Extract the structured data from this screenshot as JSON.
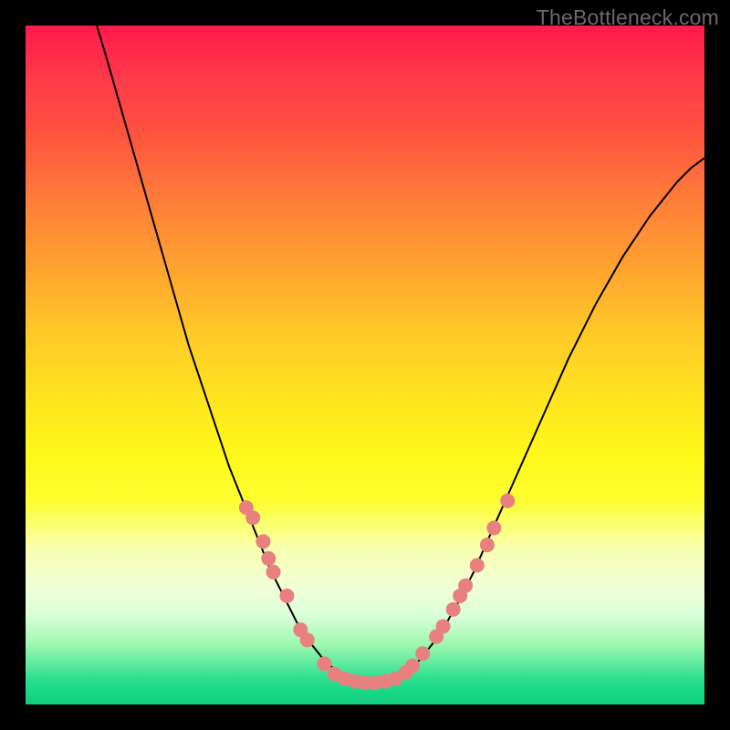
{
  "watermark": "TheBottleneck.com",
  "chart_data": {
    "type": "line",
    "title": "",
    "xlabel": "",
    "ylabel": "",
    "xlim": [
      0,
      100
    ],
    "ylim": [
      0,
      100
    ],
    "curve": {
      "comment": "V-shaped bottleneck curve; x in 0..100 plot units, y is 0 (top) to 100 (bottom) visually mapped — stored as y=percent from top",
      "points": [
        [
          10.5,
          0
        ],
        [
          12,
          5
        ],
        [
          14,
          12
        ],
        [
          16,
          19
        ],
        [
          18,
          26
        ],
        [
          20,
          33
        ],
        [
          22,
          40
        ],
        [
          24,
          47
        ],
        [
          26,
          53
        ],
        [
          28,
          59
        ],
        [
          30,
          65
        ],
        [
          32,
          70
        ],
        [
          34,
          75
        ],
        [
          36,
          80
        ],
        [
          38,
          84
        ],
        [
          40,
          88
        ],
        [
          42,
          91
        ],
        [
          44,
          93.5
        ],
        [
          46,
          95.3
        ],
        [
          48,
          96.3
        ],
        [
          50,
          96.7
        ],
        [
          52,
          96.7
        ],
        [
          54,
          96.3
        ],
        [
          56,
          95.2
        ],
        [
          58,
          93.5
        ],
        [
          60,
          91
        ],
        [
          62,
          88
        ],
        [
          64,
          84.5
        ],
        [
          66,
          80.5
        ],
        [
          68,
          76
        ],
        [
          70,
          71.5
        ],
        [
          72,
          67
        ],
        [
          74,
          62.5
        ],
        [
          76,
          58
        ],
        [
          78,
          53.5
        ],
        [
          80,
          49
        ],
        [
          82,
          45
        ],
        [
          84,
          41
        ],
        [
          86,
          37.5
        ],
        [
          88,
          34
        ],
        [
          90,
          31
        ],
        [
          92,
          28
        ],
        [
          94,
          25.5
        ],
        [
          96,
          23
        ],
        [
          98,
          21
        ],
        [
          100,
          19.5
        ]
      ]
    },
    "scatter_points": {
      "comment": "Salmon/pink data markers along the V; x,y in same 0..100 plot-percent space",
      "points": [
        [
          32.5,
          71
        ],
        [
          33.5,
          72.5
        ],
        [
          35,
          76
        ],
        [
          35.8,
          78.5
        ],
        [
          36.5,
          80.5
        ],
        [
          38.5,
          84
        ],
        [
          40.5,
          89
        ],
        [
          41.5,
          90.5
        ],
        [
          44,
          94
        ],
        [
          45.5,
          95.5
        ],
        [
          47,
          96.2
        ],
        [
          48.5,
          96.6
        ],
        [
          50,
          96.8
        ],
        [
          51.5,
          96.8
        ],
        [
          53,
          96.6
        ],
        [
          54.5,
          96.2
        ],
        [
          56,
          95.3
        ],
        [
          57,
          94.3
        ],
        [
          58.5,
          92.5
        ],
        [
          60.5,
          90
        ],
        [
          61.5,
          88.5
        ],
        [
          63,
          86
        ],
        [
          64,
          84
        ],
        [
          64.8,
          82.5
        ],
        [
          66.5,
          79.5
        ],
        [
          68,
          76.5
        ],
        [
          69,
          74
        ],
        [
          71,
          70
        ]
      ],
      "radius": 8,
      "color": "#e98080"
    }
  }
}
